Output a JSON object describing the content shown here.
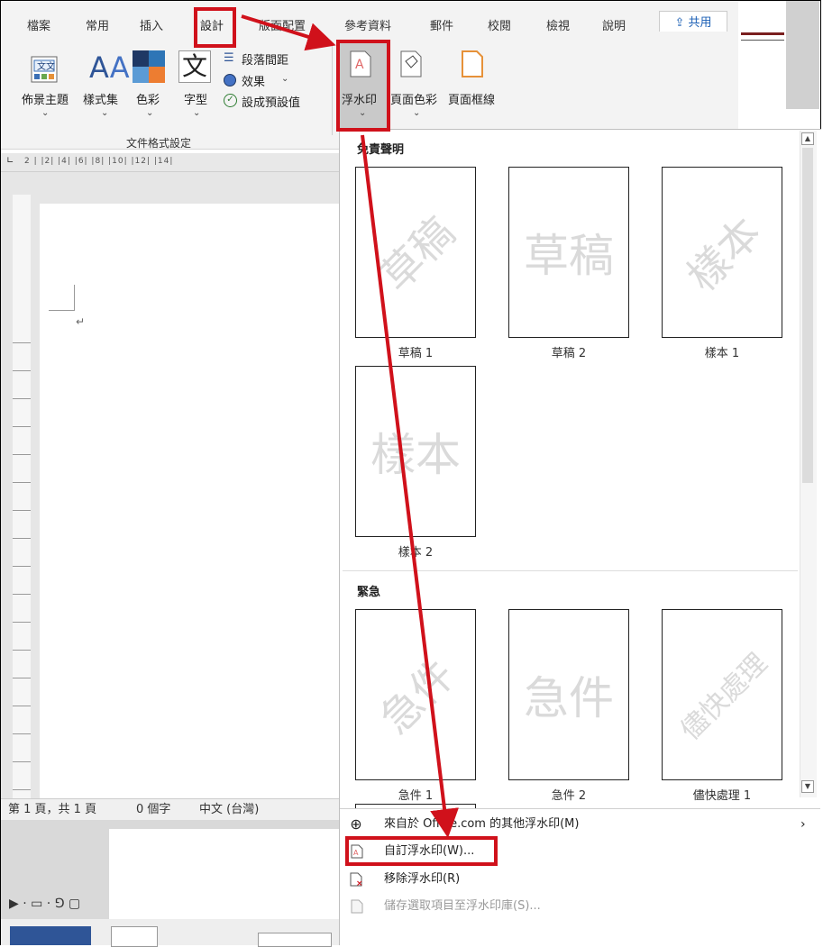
{
  "ribbon": {
    "tabs": [
      {
        "id": "file",
        "label": "檔案"
      },
      {
        "id": "home",
        "label": "常用"
      },
      {
        "id": "insert",
        "label": "插入"
      },
      {
        "id": "design",
        "label": "設計"
      },
      {
        "id": "layout",
        "label": "版面配置"
      },
      {
        "id": "references",
        "label": "參考資料"
      },
      {
        "id": "mailings",
        "label": "郵件"
      },
      {
        "id": "review",
        "label": "校閱"
      },
      {
        "id": "view",
        "label": "檢視"
      },
      {
        "id": "help",
        "label": "說明"
      }
    ],
    "share_label": "共用",
    "buttons": {
      "themes": "佈景主題",
      "style_set": "樣式集",
      "colors": "色彩",
      "fonts": "字型",
      "paragraph_spacing": "段落間距",
      "effects": "效果",
      "set_default": "設成預設值",
      "watermark": "浮水印",
      "page_color": "頁面色彩",
      "page_borders": "頁面框線"
    },
    "group_label": "文件格式設定"
  },
  "ruler": {
    "marks": "2  |  |2|  |4|  |6|  |8|  |10|  |12|  |14|"
  },
  "status_bar": {
    "page": "第 1 頁，共 1 頁",
    "words": "0 個字",
    "language": "中文 (台灣)"
  },
  "watermark_gallery": {
    "sections": [
      {
        "title": "免責聲明",
        "items": [
          {
            "caption": "草稿 1",
            "watermark": "草稿",
            "style": "diagonal"
          },
          {
            "caption": "草稿 2",
            "watermark": "草稿",
            "style": "horizontal"
          },
          {
            "caption": "樣本 1",
            "watermark": "樣本",
            "style": "diagonal"
          },
          {
            "caption": "樣本 2",
            "watermark": "樣本",
            "style": "horizontal"
          }
        ]
      },
      {
        "title": "緊急",
        "items": [
          {
            "caption": "急件 1",
            "watermark": "急件",
            "style": "diagonal"
          },
          {
            "caption": "急件 2",
            "watermark": "急件",
            "style": "horizontal"
          },
          {
            "caption": "儘快處理 1",
            "watermark": "儘快處理",
            "style": "diagonal"
          }
        ]
      }
    ]
  },
  "menu": {
    "more_from_office": "來自於 Office.com 的其他浮水印(M)",
    "custom_watermark": "自訂浮水印(W)...",
    "remove_watermark": "移除浮水印(R)",
    "save_selection": "儲存選取項目至浮水印庫(S)..."
  },
  "colors": {
    "accent": "#1b5fb5",
    "annotation_red": "#d0111b",
    "ribbon_bg": "#f3f3f3",
    "watermark_gray": "#dadada"
  }
}
